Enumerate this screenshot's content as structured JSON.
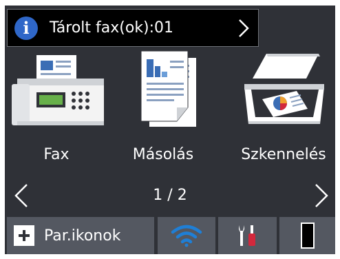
{
  "notification": {
    "text": "Tárolt fax(ok):01",
    "icon": "info-icon",
    "icon_glyph": "i"
  },
  "apps": [
    {
      "label": "Fax",
      "icon": "fax-machine-icon"
    },
    {
      "label": "Másolás",
      "icon": "copy-documents-icon"
    },
    {
      "label": "Szkennelés",
      "icon": "scanner-icon"
    }
  ],
  "pager": {
    "text": "1 / 2"
  },
  "bottom_bar": {
    "shortcuts_label": "Par.ikonok",
    "wifi_icon": "wifi-icon",
    "settings_icon": "settings-tools-icon",
    "toner_icon": "toner-level-icon"
  },
  "colors": {
    "background": "#2f3137",
    "button": "#545861",
    "info_blue": "#2f67c8",
    "wifi_blue": "#1f7fd6",
    "tool_red": "#d2283c",
    "toner_black": "#000000"
  }
}
